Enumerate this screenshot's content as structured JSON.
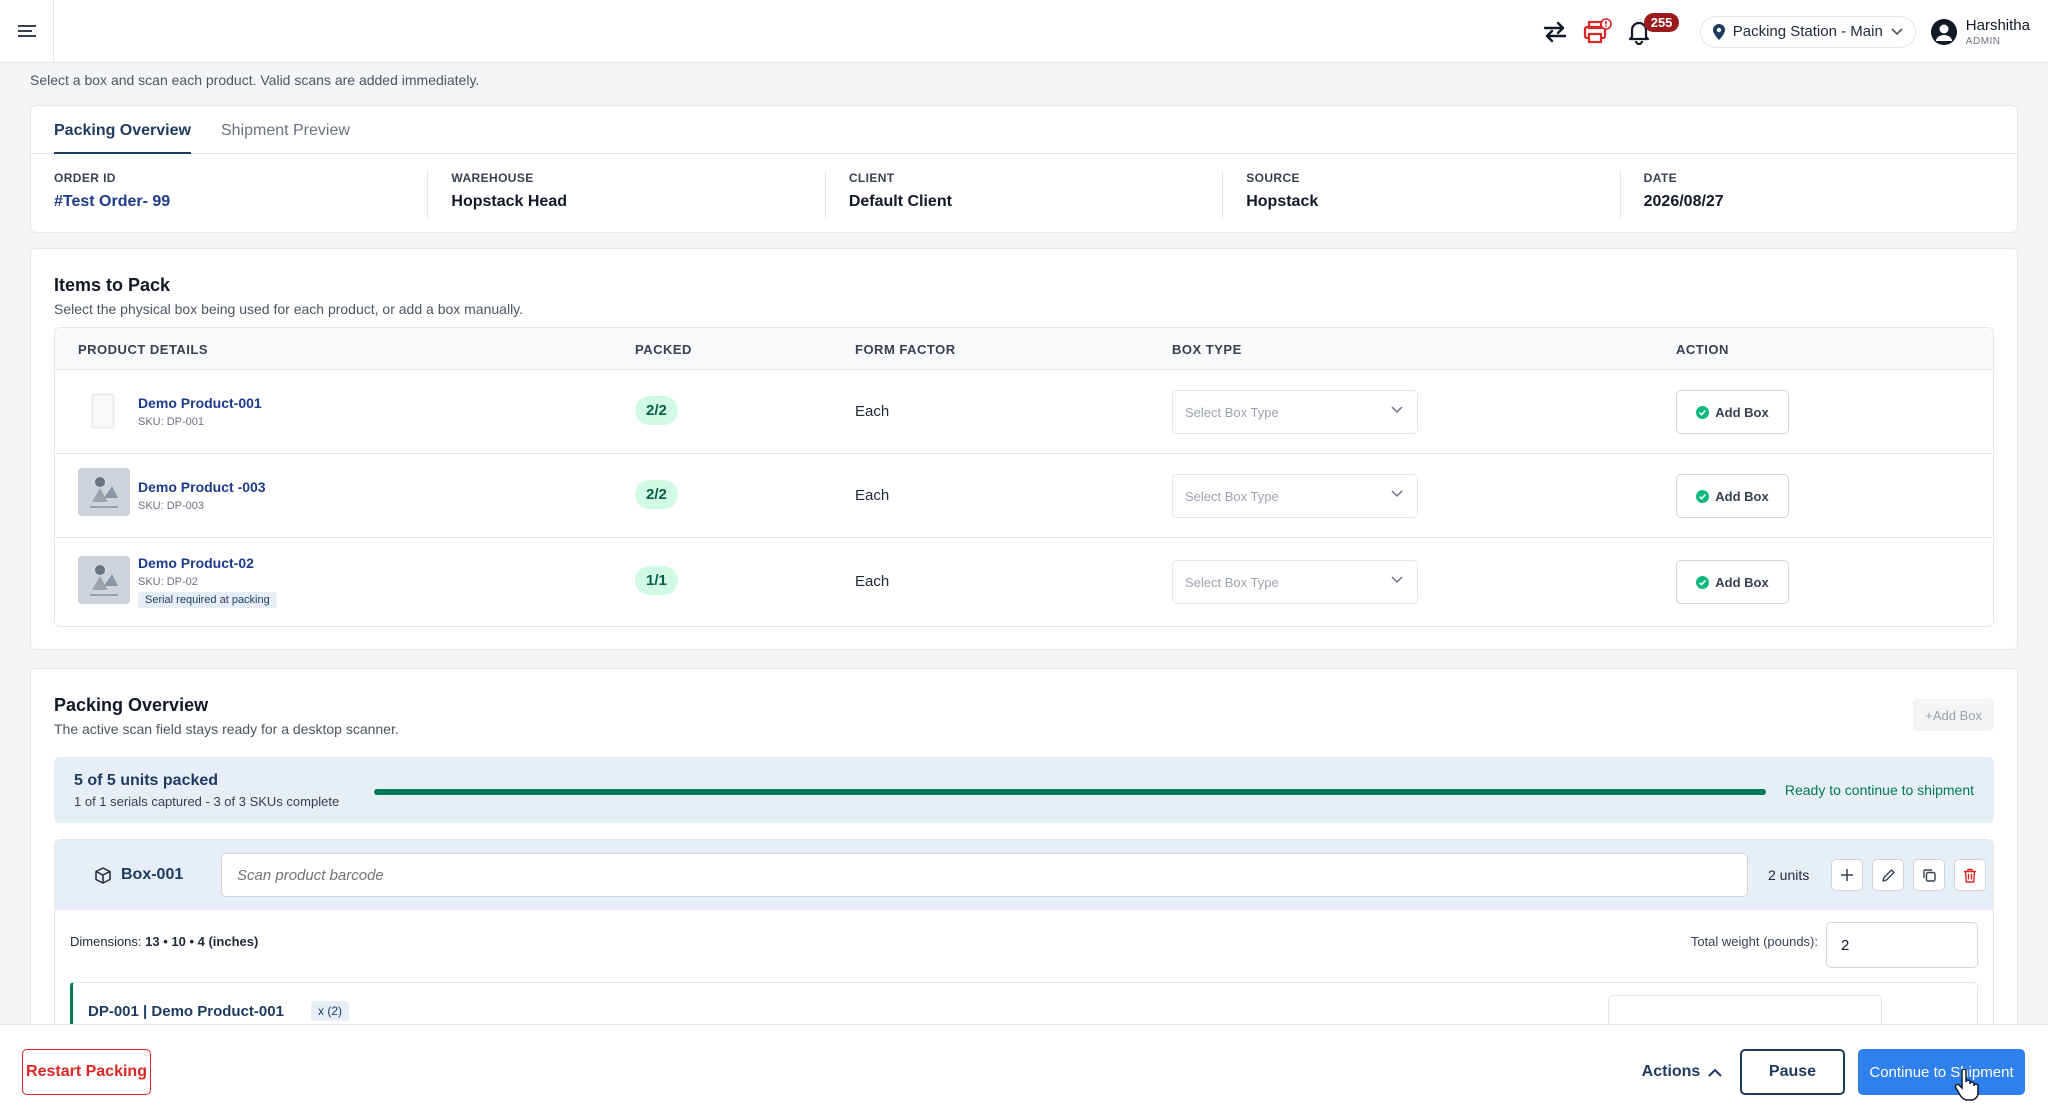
{
  "topbar": {
    "notification_count": "255",
    "station_label": "Packing Station - Main",
    "user_name": "Harshitha",
    "user_role": "ADMIN"
  },
  "page_subtitle": "Select a box and scan each product. Valid scans are added immediately.",
  "tabs": [
    {
      "label": "Packing Overview",
      "active": true
    },
    {
      "label": "Shipment Preview",
      "active": false
    }
  ],
  "order_info": {
    "order_id_label": "ORDER ID",
    "order_id": "#Test Order- 99",
    "warehouse_label": "WAREHOUSE",
    "warehouse": "Hopstack Head",
    "client_label": "CLIENT",
    "client": "Default Client",
    "source_label": "SOURCE",
    "source": "Hopstack",
    "date_label": "DATE",
    "date": "2026/08/27"
  },
  "items_section": {
    "title": "Items to Pack",
    "subtitle": "Select the physical box being used for each product, or add a box manually.",
    "columns": [
      "PRODUCT DETAILS",
      "PACKED",
      "FORM FACTOR",
      "BOX TYPE",
      "ACTION"
    ],
    "rows": [
      {
        "name": "Demo Product-001",
        "sku": "SKU: DP-001",
        "packed": "2/2",
        "form_factor": "Each",
        "box_placeholder": "Select Box Type",
        "action": "Add Box",
        "serial": ""
      },
      {
        "name": "Demo Product -003",
        "sku": "SKU: DP-003",
        "packed": "2/2",
        "form_factor": "Each",
        "box_placeholder": "Select Box Type",
        "action": "Add Box",
        "serial": ""
      },
      {
        "name": "Demo Product-02",
        "sku": "SKU: DP-02",
        "packed": "1/1",
        "form_factor": "Each",
        "box_placeholder": "Select Box Type",
        "action": "Add Box",
        "serial": "Serial required at packing"
      }
    ]
  },
  "packing_section": {
    "title": "Packing Overview",
    "subtitle": "The active scan field stays ready for a desktop scanner.",
    "add_box_label": "+Add Box",
    "progress_title": "5 of 5 units packed",
    "progress_sub": "1 of 1 serials captured - 3 of 3 SKUs complete",
    "progress_fraction": 1.0,
    "progress_status": "Ready to continue to shipment"
  },
  "box": {
    "name": "Box-001",
    "scan_placeholder": "Scan product barcode",
    "units": "2 units",
    "dimensions_label": "Dimensions:",
    "dimensions_value": "13 • 10 • 4 (inches)",
    "weight_label": "Total weight (pounds):",
    "weight_value": "2",
    "line_item": "DP-001 | Demo Product-001",
    "line_qty": "x (2)"
  },
  "footer": {
    "restart_label": "Restart Packing",
    "actions_label": "Actions",
    "pause_label": "Pause",
    "continue_label": "Continue to Shipment"
  },
  "colors": {
    "accent": "#1e3a5f",
    "primary_button": "#2f80ed",
    "danger": "#dc2626",
    "success": "#047857"
  }
}
